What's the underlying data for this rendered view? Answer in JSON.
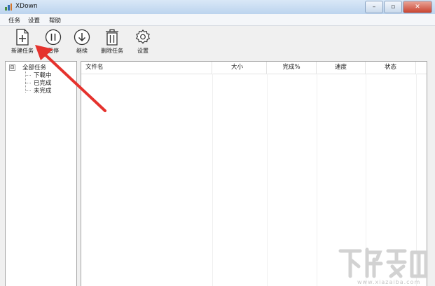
{
  "window": {
    "title": "XDown",
    "controls": [
      "–",
      "▫",
      "✕"
    ]
  },
  "menu": [
    "任务",
    "设置",
    "帮助"
  ],
  "toolbar": [
    {
      "label": "新建任务",
      "icon": "new-task-icon"
    },
    {
      "label": "暂停",
      "icon": "pause-icon"
    },
    {
      "label": "继续",
      "icon": "resume-icon"
    },
    {
      "label": "删除任务",
      "icon": "delete-icon"
    },
    {
      "label": "设置",
      "icon": "gear-icon"
    }
  ],
  "tree": {
    "root": "全部任务",
    "expander": "⊟",
    "children": [
      "下载中",
      "已完成",
      "未完成"
    ]
  },
  "list": {
    "columns": [
      "文件名",
      "大小",
      "完成%",
      "速度",
      "状态"
    ]
  },
  "watermark": {
    "text": "www.xiazaiba.com"
  },
  "colors": {
    "arrow": "#e5322d",
    "titlebar": "#c6daf1",
    "close": "#c9432f"
  }
}
